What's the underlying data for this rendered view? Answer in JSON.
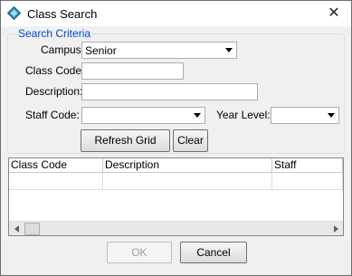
{
  "window": {
    "title": "Class Search",
    "close_glyph": "✕"
  },
  "criteria": {
    "legend": "Search Criteria",
    "campus_label": "Campus:",
    "campus_value": "Senior",
    "class_code_label": "Class Code:",
    "class_code_value": "",
    "description_label": "Description:",
    "description_value": "",
    "staff_code_label": "Staff Code:",
    "staff_code_value": "",
    "year_level_label": "Year Level:",
    "year_level_value": "",
    "refresh_label": "Refresh Grid",
    "clear_label": "Clear"
  },
  "grid": {
    "columns": [
      "Class Code",
      "Description",
      "Staff"
    ]
  },
  "footer": {
    "ok_label": "OK",
    "cancel_label": "Cancel"
  },
  "colors": {
    "legend": "#0046d5",
    "window_bg": "#f0f0f0",
    "title_bg": "#ffffff"
  },
  "icons": {
    "app": "app-diamond-icon",
    "dropdown": "chevron-down-icon"
  }
}
